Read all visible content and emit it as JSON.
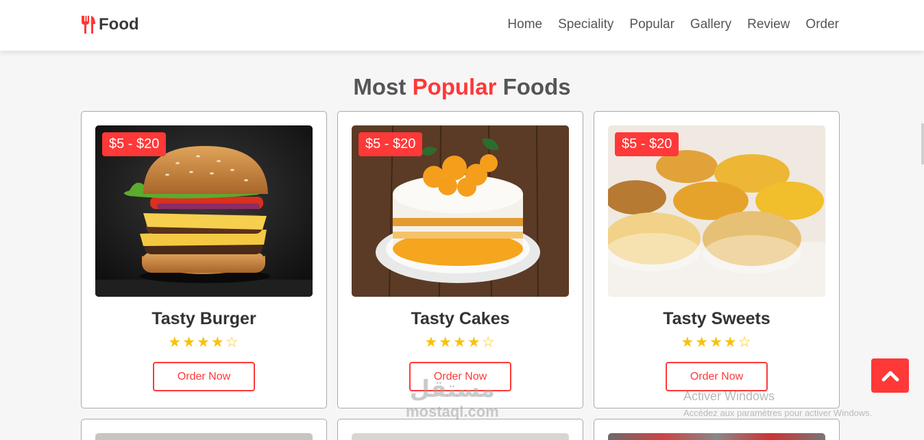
{
  "header": {
    "logo_text": "Food",
    "nav": [
      "Home",
      "Speciality",
      "Popular",
      "Gallery",
      "Review",
      "Order"
    ]
  },
  "section": {
    "title_part1": "Most",
    "title_accent": "Popular",
    "title_part2": "Foods"
  },
  "cards": [
    {
      "price": "$5 - $20",
      "title": "Tasty Burger",
      "rating": 4,
      "max_rating": 5,
      "button": "Order Now",
      "image": "burger"
    },
    {
      "price": "$5 - $20",
      "title": "Tasty Cakes",
      "rating": 4,
      "max_rating": 5,
      "button": "Order Now",
      "image": "cake"
    },
    {
      "price": "$5 - $20",
      "title": "Tasty Sweets",
      "rating": 4,
      "max_rating": 5,
      "button": "Order Now",
      "image": "snacks"
    }
  ],
  "overlay": {
    "activate_title": "Activer Windows",
    "activate_sub": "Accédez aux paramètres pour activer Windows.",
    "site_mark_ar": "مستقل",
    "site_mark_en": "mostaql.com"
  },
  "colors": {
    "accent": "#ff3838",
    "star": "#f7c20a",
    "text": "#333333"
  },
  "icons": {
    "logo": "utensils-icon",
    "scroll_top": "chevron-up-icon",
    "star_full": "star-icon",
    "star_empty": "star-outline-icon"
  }
}
